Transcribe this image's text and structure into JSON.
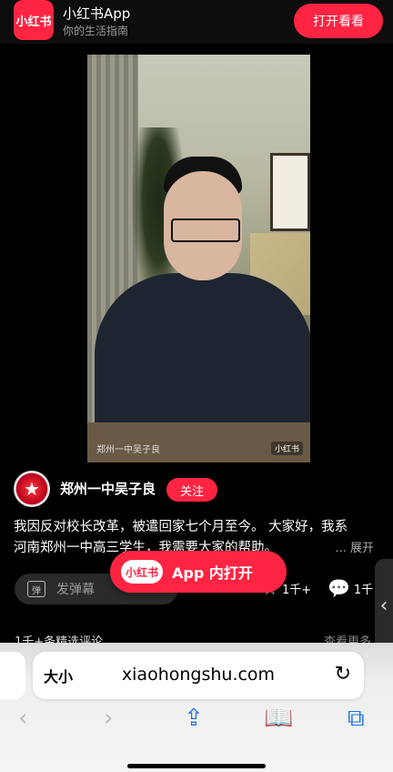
{
  "banner": {
    "logo_text": "小红书",
    "app_name": "小红书App",
    "tagline": "你的生活指南",
    "open_button": "打开看看"
  },
  "video": {
    "watermark_label": "郑州一中吴子良",
    "watermark_badge": "小红书"
  },
  "post": {
    "author": "郑州一中吴子良",
    "follow_label": "关注",
    "desc_line1": "我因反对校长改革，被遣回家七个月至今。 大家好，我系",
    "desc_line2": "河南郑州一中高三学生，我需要大家的帮助。",
    "expand_label": "... 展开"
  },
  "actions": {
    "danmu_icon": "弹",
    "danmu_placeholder": "发弹幕",
    "collect_count": "1千+",
    "comment_count": "1千"
  },
  "open_in_app": {
    "logo_text": "小红书",
    "label": "App 内打开"
  },
  "comments": {
    "summary": "1千+条精选评论",
    "see_more": "查看更多"
  },
  "safari": {
    "text_size_label": "大小",
    "url": "xiaohongshu.com"
  },
  "colors": {
    "brand_red": "#ff2442",
    "background": "#000000"
  },
  "icons": {
    "back": "chevron-left-icon",
    "forward": "chevron-right-icon",
    "share": "share-icon",
    "bookmarks": "book-icon",
    "tabs": "tabs-icon",
    "reload": "reload-icon"
  }
}
